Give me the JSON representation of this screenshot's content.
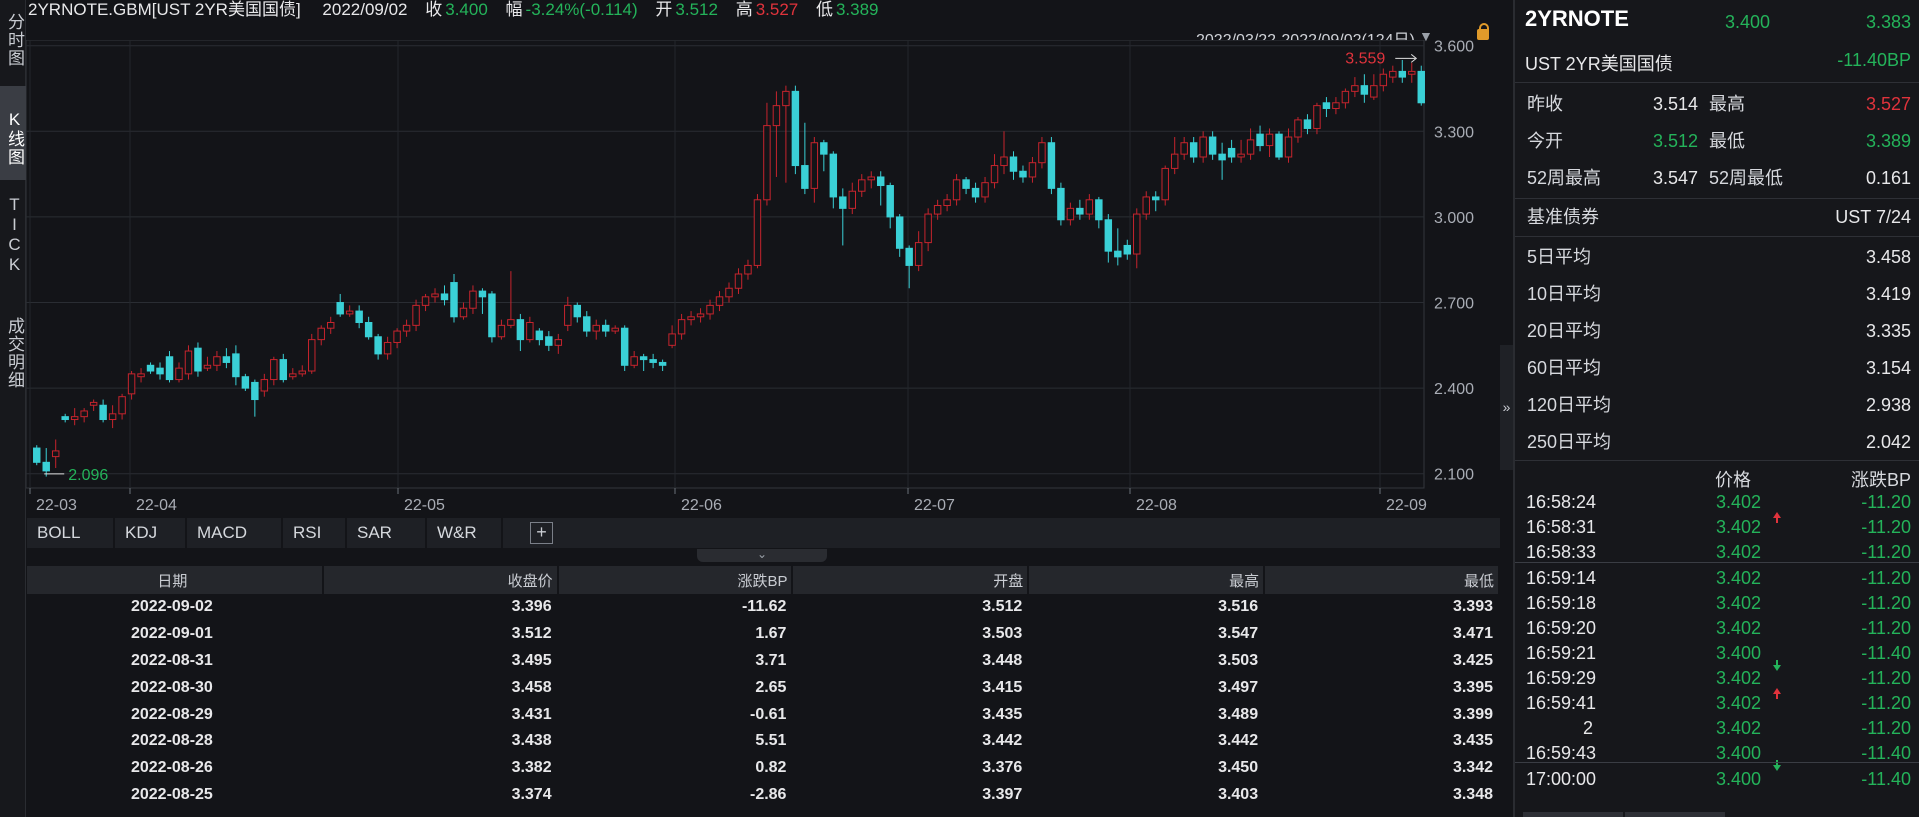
{
  "left_tabs": [
    {
      "label": "分时图"
    },
    {
      "label": "K线图"
    },
    {
      "label": "TICK"
    },
    {
      "label": "成交明细"
    }
  ],
  "header": {
    "symbol": "2YRNOTE.GBM[UST 2YR美国国债]",
    "date": "2022/09/02",
    "close_label": "收",
    "close": "3.400",
    "change_label": "幅",
    "change": "-3.24%(-0.114)",
    "open_label": "开",
    "open": "3.512",
    "high_label": "高",
    "high": "3.527",
    "low_label": "低",
    "low": "3.389",
    "range": "2022/03/22-2022/09/02(124日)"
  },
  "chart_data": {
    "type": "candlestick",
    "ylim": [
      2.05,
      3.62
    ],
    "y_ticks": [
      "3.600",
      "3.300",
      "3.000",
      "2.700",
      "2.400",
      "2.100"
    ],
    "x_ticks": [
      "22-03",
      "22-04",
      "22-05",
      "22-06",
      "22-07",
      "22-08",
      "22-09"
    ],
    "max_label": "3.559",
    "min_label": "2.096",
    "grid": true,
    "colors": {
      "up": "#c6242d",
      "down": "#3ad0d6"
    },
    "candles": [
      [
        2.19,
        2.14,
        2.2,
        2.13
      ],
      [
        2.14,
        2.11,
        2.19,
        2.09
      ],
      [
        2.16,
        2.18,
        2.22,
        2.12
      ],
      [
        2.3,
        2.29,
        2.31,
        2.28
      ],
      [
        2.29,
        2.3,
        2.33,
        2.27
      ],
      [
        2.3,
        2.32,
        2.33,
        2.28
      ],
      [
        2.34,
        2.35,
        2.36,
        2.32
      ],
      [
        2.34,
        2.29,
        2.36,
        2.28
      ],
      [
        2.29,
        2.31,
        2.34,
        2.26
      ],
      [
        2.31,
        2.37,
        2.38,
        2.29
      ],
      [
        2.38,
        2.45,
        2.46,
        2.36
      ],
      [
        2.44,
        2.45,
        2.47,
        2.42
      ],
      [
        2.48,
        2.46,
        2.49,
        2.45
      ],
      [
        2.47,
        2.45,
        2.49,
        2.43
      ],
      [
        2.51,
        2.43,
        2.53,
        2.42
      ],
      [
        2.43,
        2.47,
        2.49,
        2.42
      ],
      [
        2.45,
        2.53,
        2.55,
        2.43
      ],
      [
        2.54,
        2.46,
        2.56,
        2.44
      ],
      [
        2.47,
        2.48,
        2.51,
        2.46
      ],
      [
        2.48,
        2.51,
        2.53,
        2.46
      ],
      [
        2.51,
        2.49,
        2.54,
        2.47
      ],
      [
        2.52,
        2.44,
        2.55,
        2.41
      ],
      [
        2.44,
        2.4,
        2.45,
        2.39
      ],
      [
        2.42,
        2.36,
        2.43,
        2.3
      ],
      [
        2.39,
        2.43,
        2.45,
        2.37
      ],
      [
        2.43,
        2.5,
        2.51,
        2.41
      ],
      [
        2.5,
        2.43,
        2.52,
        2.42
      ],
      [
        2.44,
        2.45,
        2.47,
        2.43
      ],
      [
        2.45,
        2.46,
        2.48,
        2.44
      ],
      [
        2.46,
        2.57,
        2.59,
        2.45
      ],
      [
        2.57,
        2.61,
        2.62,
        2.55
      ],
      [
        2.61,
        2.63,
        2.65,
        2.59
      ],
      [
        2.7,
        2.66,
        2.73,
        2.65
      ],
      [
        2.66,
        2.67,
        2.69,
        2.65
      ],
      [
        2.67,
        2.63,
        2.69,
        2.61
      ],
      [
        2.63,
        2.58,
        2.65,
        2.57
      ],
      [
        2.58,
        2.52,
        2.59,
        2.5
      ],
      [
        2.52,
        2.56,
        2.58,
        2.5
      ],
      [
        2.56,
        2.6,
        2.61,
        2.54
      ],
      [
        2.6,
        2.62,
        2.64,
        2.58
      ],
      [
        2.62,
        2.69,
        2.71,
        2.6
      ],
      [
        2.69,
        2.72,
        2.73,
        2.67
      ],
      [
        2.72,
        2.73,
        2.75,
        2.7
      ],
      [
        2.73,
        2.71,
        2.76,
        2.69
      ],
      [
        2.77,
        2.65,
        2.8,
        2.63
      ],
      [
        2.65,
        2.68,
        2.7,
        2.64
      ],
      [
        2.68,
        2.74,
        2.76,
        2.66
      ],
      [
        2.74,
        2.72,
        2.75,
        2.66
      ],
      [
        2.73,
        2.58,
        2.74,
        2.56
      ],
      [
        2.58,
        2.62,
        2.64,
        2.57
      ],
      [
        2.62,
        2.64,
        2.81,
        2.61
      ],
      [
        2.64,
        2.57,
        2.66,
        2.53
      ],
      [
        2.57,
        2.63,
        2.65,
        2.56
      ],
      [
        2.6,
        2.57,
        2.61,
        2.55
      ],
      [
        2.58,
        2.55,
        2.6,
        2.53
      ],
      [
        2.55,
        2.57,
        2.59,
        2.52
      ],
      [
        2.62,
        2.69,
        2.72,
        2.6
      ],
      [
        2.69,
        2.65,
        2.7,
        2.63
      ],
      [
        2.65,
        2.6,
        2.67,
        2.58
      ],
      [
        2.6,
        2.62,
        2.64,
        2.57
      ],
      [
        2.62,
        2.6,
        2.64,
        2.58
      ],
      [
        2.6,
        2.61,
        2.62,
        2.59
      ],
      [
        2.61,
        2.48,
        2.62,
        2.46
      ],
      [
        2.48,
        2.51,
        2.53,
        2.47
      ],
      [
        2.51,
        2.5,
        2.52,
        2.46
      ],
      [
        2.5,
        2.49,
        2.52,
        2.47
      ],
      [
        2.49,
        2.48,
        2.5,
        2.46
      ],
      [
        2.55,
        2.59,
        2.62,
        2.54
      ],
      [
        2.59,
        2.64,
        2.66,
        2.57
      ],
      [
        2.64,
        2.65,
        2.67,
        2.62
      ],
      [
        2.65,
        2.66,
        2.68,
        2.63
      ],
      [
        2.66,
        2.69,
        2.71,
        2.64
      ],
      [
        2.69,
        2.72,
        2.74,
        2.67
      ],
      [
        2.72,
        2.75,
        2.77,
        2.7
      ],
      [
        2.75,
        2.8,
        2.82,
        2.73
      ],
      [
        2.8,
        2.83,
        2.85,
        2.78
      ],
      [
        2.83,
        3.06,
        3.08,
        2.82
      ],
      [
        3.06,
        3.32,
        3.4,
        3.04
      ],
      [
        3.32,
        3.39,
        3.44,
        3.14
      ],
      [
        3.39,
        3.44,
        3.46,
        3.12
      ],
      [
        3.44,
        3.18,
        3.46,
        3.15
      ],
      [
        3.18,
        3.1,
        3.33,
        3.08
      ],
      [
        3.1,
        3.26,
        3.28,
        3.05
      ],
      [
        3.26,
        3.22,
        3.27,
        3.16
      ],
      [
        3.22,
        3.07,
        3.23,
        3.03
      ],
      [
        3.07,
        3.03,
        3.1,
        2.9
      ],
      [
        3.03,
        3.09,
        3.12,
        3.01
      ],
      [
        3.09,
        3.13,
        3.15,
        3.07
      ],
      [
        3.13,
        3.14,
        3.16,
        3.1
      ],
      [
        3.14,
        3.11,
        3.16,
        3.04
      ],
      [
        3.11,
        3.0,
        3.12,
        2.96
      ],
      [
        3.0,
        2.89,
        3.01,
        2.86
      ],
      [
        2.89,
        2.83,
        2.9,
        2.75
      ],
      [
        2.83,
        2.91,
        2.95,
        2.81
      ],
      [
        2.91,
        3.01,
        3.03,
        2.88
      ],
      [
        3.01,
        3.04,
        3.06,
        2.99
      ],
      [
        3.04,
        3.06,
        3.08,
        3.02
      ],
      [
        3.06,
        3.13,
        3.15,
        3.04
      ],
      [
        3.13,
        3.1,
        3.14,
        3.08
      ],
      [
        3.1,
        3.07,
        3.12,
        3.05
      ],
      [
        3.07,
        3.12,
        3.14,
        3.05
      ],
      [
        3.12,
        3.18,
        3.22,
        3.1
      ],
      [
        3.18,
        3.21,
        3.3,
        3.15
      ],
      [
        3.21,
        3.16,
        3.23,
        3.13
      ],
      [
        3.16,
        3.14,
        3.18,
        3.12
      ],
      [
        3.14,
        3.19,
        3.21,
        3.12
      ],
      [
        3.19,
        3.26,
        3.28,
        3.17
      ],
      [
        3.26,
        3.1,
        3.28,
        3.08
      ],
      [
        3.1,
        2.99,
        3.12,
        2.97
      ],
      [
        2.99,
        3.03,
        3.05,
        2.97
      ],
      [
        3.03,
        3.01,
        3.06,
        2.99
      ],
      [
        3.01,
        3.06,
        3.08,
        2.99
      ],
      [
        3.06,
        2.99,
        3.07,
        2.96
      ],
      [
        2.99,
        2.88,
        3.01,
        2.84
      ],
      [
        2.88,
        2.86,
        2.96,
        2.83
      ],
      [
        2.9,
        2.87,
        2.92,
        2.85
      ],
      [
        2.87,
        3.01,
        3.03,
        2.82
      ],
      [
        3.01,
        3.07,
        3.09,
        2.99
      ],
      [
        3.07,
        3.06,
        3.09,
        3.02
      ],
      [
        3.06,
        3.17,
        3.18,
        3.04
      ],
      [
        3.17,
        3.22,
        3.28,
        3.15
      ],
      [
        3.22,
        3.26,
        3.28,
        3.2
      ],
      [
        3.26,
        3.21,
        3.28,
        3.19
      ],
      [
        3.21,
        3.28,
        3.3,
        3.19
      ],
      [
        3.28,
        3.22,
        3.3,
        3.2
      ],
      [
        3.22,
        3.2,
        3.26,
        3.13
      ],
      [
        3.24,
        3.21,
        3.27,
        3.19
      ],
      [
        3.21,
        3.22,
        3.27,
        3.19
      ],
      [
        3.22,
        3.27,
        3.31,
        3.2
      ],
      [
        3.29,
        3.25,
        3.32,
        3.23
      ],
      [
        3.25,
        3.29,
        3.31,
        3.21
      ],
      [
        3.29,
        3.21,
        3.3,
        3.2
      ],
      [
        3.21,
        3.28,
        3.31,
        3.19
      ],
      [
        3.28,
        3.34,
        3.35,
        3.26
      ],
      [
        3.34,
        3.31,
        3.36,
        3.29
      ],
      [
        3.31,
        3.39,
        3.4,
        3.29
      ],
      [
        3.4,
        3.38,
        3.42,
        3.35
      ],
      [
        3.38,
        3.4,
        3.42,
        3.36
      ],
      [
        3.4,
        3.44,
        3.45,
        3.38
      ],
      [
        3.44,
        3.46,
        3.49,
        3.42
      ],
      [
        3.46,
        3.43,
        3.5,
        3.4
      ],
      [
        3.42,
        3.46,
        3.5,
        3.41
      ],
      [
        3.46,
        3.5,
        3.52,
        3.44
      ],
      [
        3.49,
        3.51,
        3.53,
        3.47
      ],
      [
        3.51,
        3.49,
        3.55,
        3.47
      ],
      [
        3.5,
        3.51,
        3.54,
        3.47
      ],
      [
        3.51,
        3.4,
        3.53,
        3.39
      ]
    ]
  },
  "indicator_tabs": [
    "BOLL",
    "KDJ",
    "MACD",
    "RSI",
    "SAR",
    "W&R"
  ],
  "table": {
    "headers": [
      "日期",
      "收盘价",
      "涨跌BP",
      "开盘",
      "最高",
      "最低"
    ],
    "rows": [
      [
        "2022-09-02",
        "3.396",
        "-11.62",
        "3.512",
        "3.516",
        "3.393"
      ],
      [
        "2022-09-01",
        "3.512",
        "1.67",
        "3.503",
        "3.547",
        "3.471"
      ],
      [
        "2022-08-31",
        "3.495",
        "3.71",
        "3.448",
        "3.503",
        "3.425"
      ],
      [
        "2022-08-30",
        "3.458",
        "2.65",
        "3.415",
        "3.497",
        "3.395"
      ],
      [
        "2022-08-29",
        "3.431",
        "-0.61",
        "3.435",
        "3.489",
        "3.399"
      ],
      [
        "2022-08-28",
        "3.438",
        "5.51",
        "3.442",
        "3.442",
        "3.435"
      ],
      [
        "2022-08-26",
        "3.382",
        "0.82",
        "3.376",
        "3.450",
        "3.342"
      ],
      [
        "2022-08-25",
        "3.374",
        "-2.86",
        "3.397",
        "3.403",
        "3.348"
      ]
    ]
  },
  "quote": {
    "code": "2YRNOTE",
    "price": "3.400",
    "price2": "3.383",
    "name": "UST 2YR美国国债",
    "change_bp": "-11.40BP",
    "prev_close_label": "昨收",
    "prev_close": "3.514",
    "high_label": "最高",
    "high": "3.527",
    "open_label": "今开",
    "open": "3.512",
    "low_label": "最低",
    "low": "3.389",
    "w52_high_label": "52周最高",
    "w52_high": "3.547",
    "w52_low_label": "52周最低",
    "w52_low": "0.161",
    "bench_label": "基准债券",
    "bench": "UST 7/24",
    "ma": [
      {
        "label": "5日平均",
        "value": "3.458"
      },
      {
        "label": "10日平均",
        "value": "3.419"
      },
      {
        "label": "20日平均",
        "value": "3.335"
      },
      {
        "label": "60日平均",
        "value": "3.154"
      },
      {
        "label": "120日平均",
        "value": "2.938"
      },
      {
        "label": "250日平均",
        "value": "2.042"
      }
    ]
  },
  "ticks": {
    "price_header": "价格",
    "change_header": "涨跌BP",
    "rows": [
      {
        "time": "16:58:24",
        "price": "3.402",
        "arrow": "up",
        "change": "-11.20"
      },
      {
        "time": "16:58:31",
        "price": "3.402",
        "arrow": "",
        "change": "-11.20"
      },
      {
        "time": "16:58:33",
        "price": "3.402",
        "arrow": "",
        "change": "-11.20"
      },
      {
        "time": "16:59:14",
        "price": "3.402",
        "arrow": "",
        "change": "-11.20"
      },
      {
        "time": "16:59:18",
        "price": "3.402",
        "arrow": "",
        "change": "-11.20"
      },
      {
        "time": "16:59:20",
        "price": "3.402",
        "arrow": "",
        "change": "-11.20"
      },
      {
        "time": "16:59:21",
        "price": "3.400",
        "arrow": "down",
        "change": "-11.40"
      },
      {
        "time": "16:59:29",
        "price": "3.402",
        "arrow": "up",
        "change": "-11.20"
      },
      {
        "time": "16:59:41",
        "price": "3.402",
        "arrow": "",
        "change": "-11.20"
      },
      {
        "time": "2",
        "price": "3.402",
        "arrow": "",
        "change": "-11.20"
      },
      {
        "time": "16:59:43",
        "price": "3.400",
        "arrow": "down",
        "change": "-11.40"
      },
      {
        "time": "17:00:00",
        "price": "3.400",
        "arrow": "",
        "change": "-11.40"
      }
    ]
  }
}
